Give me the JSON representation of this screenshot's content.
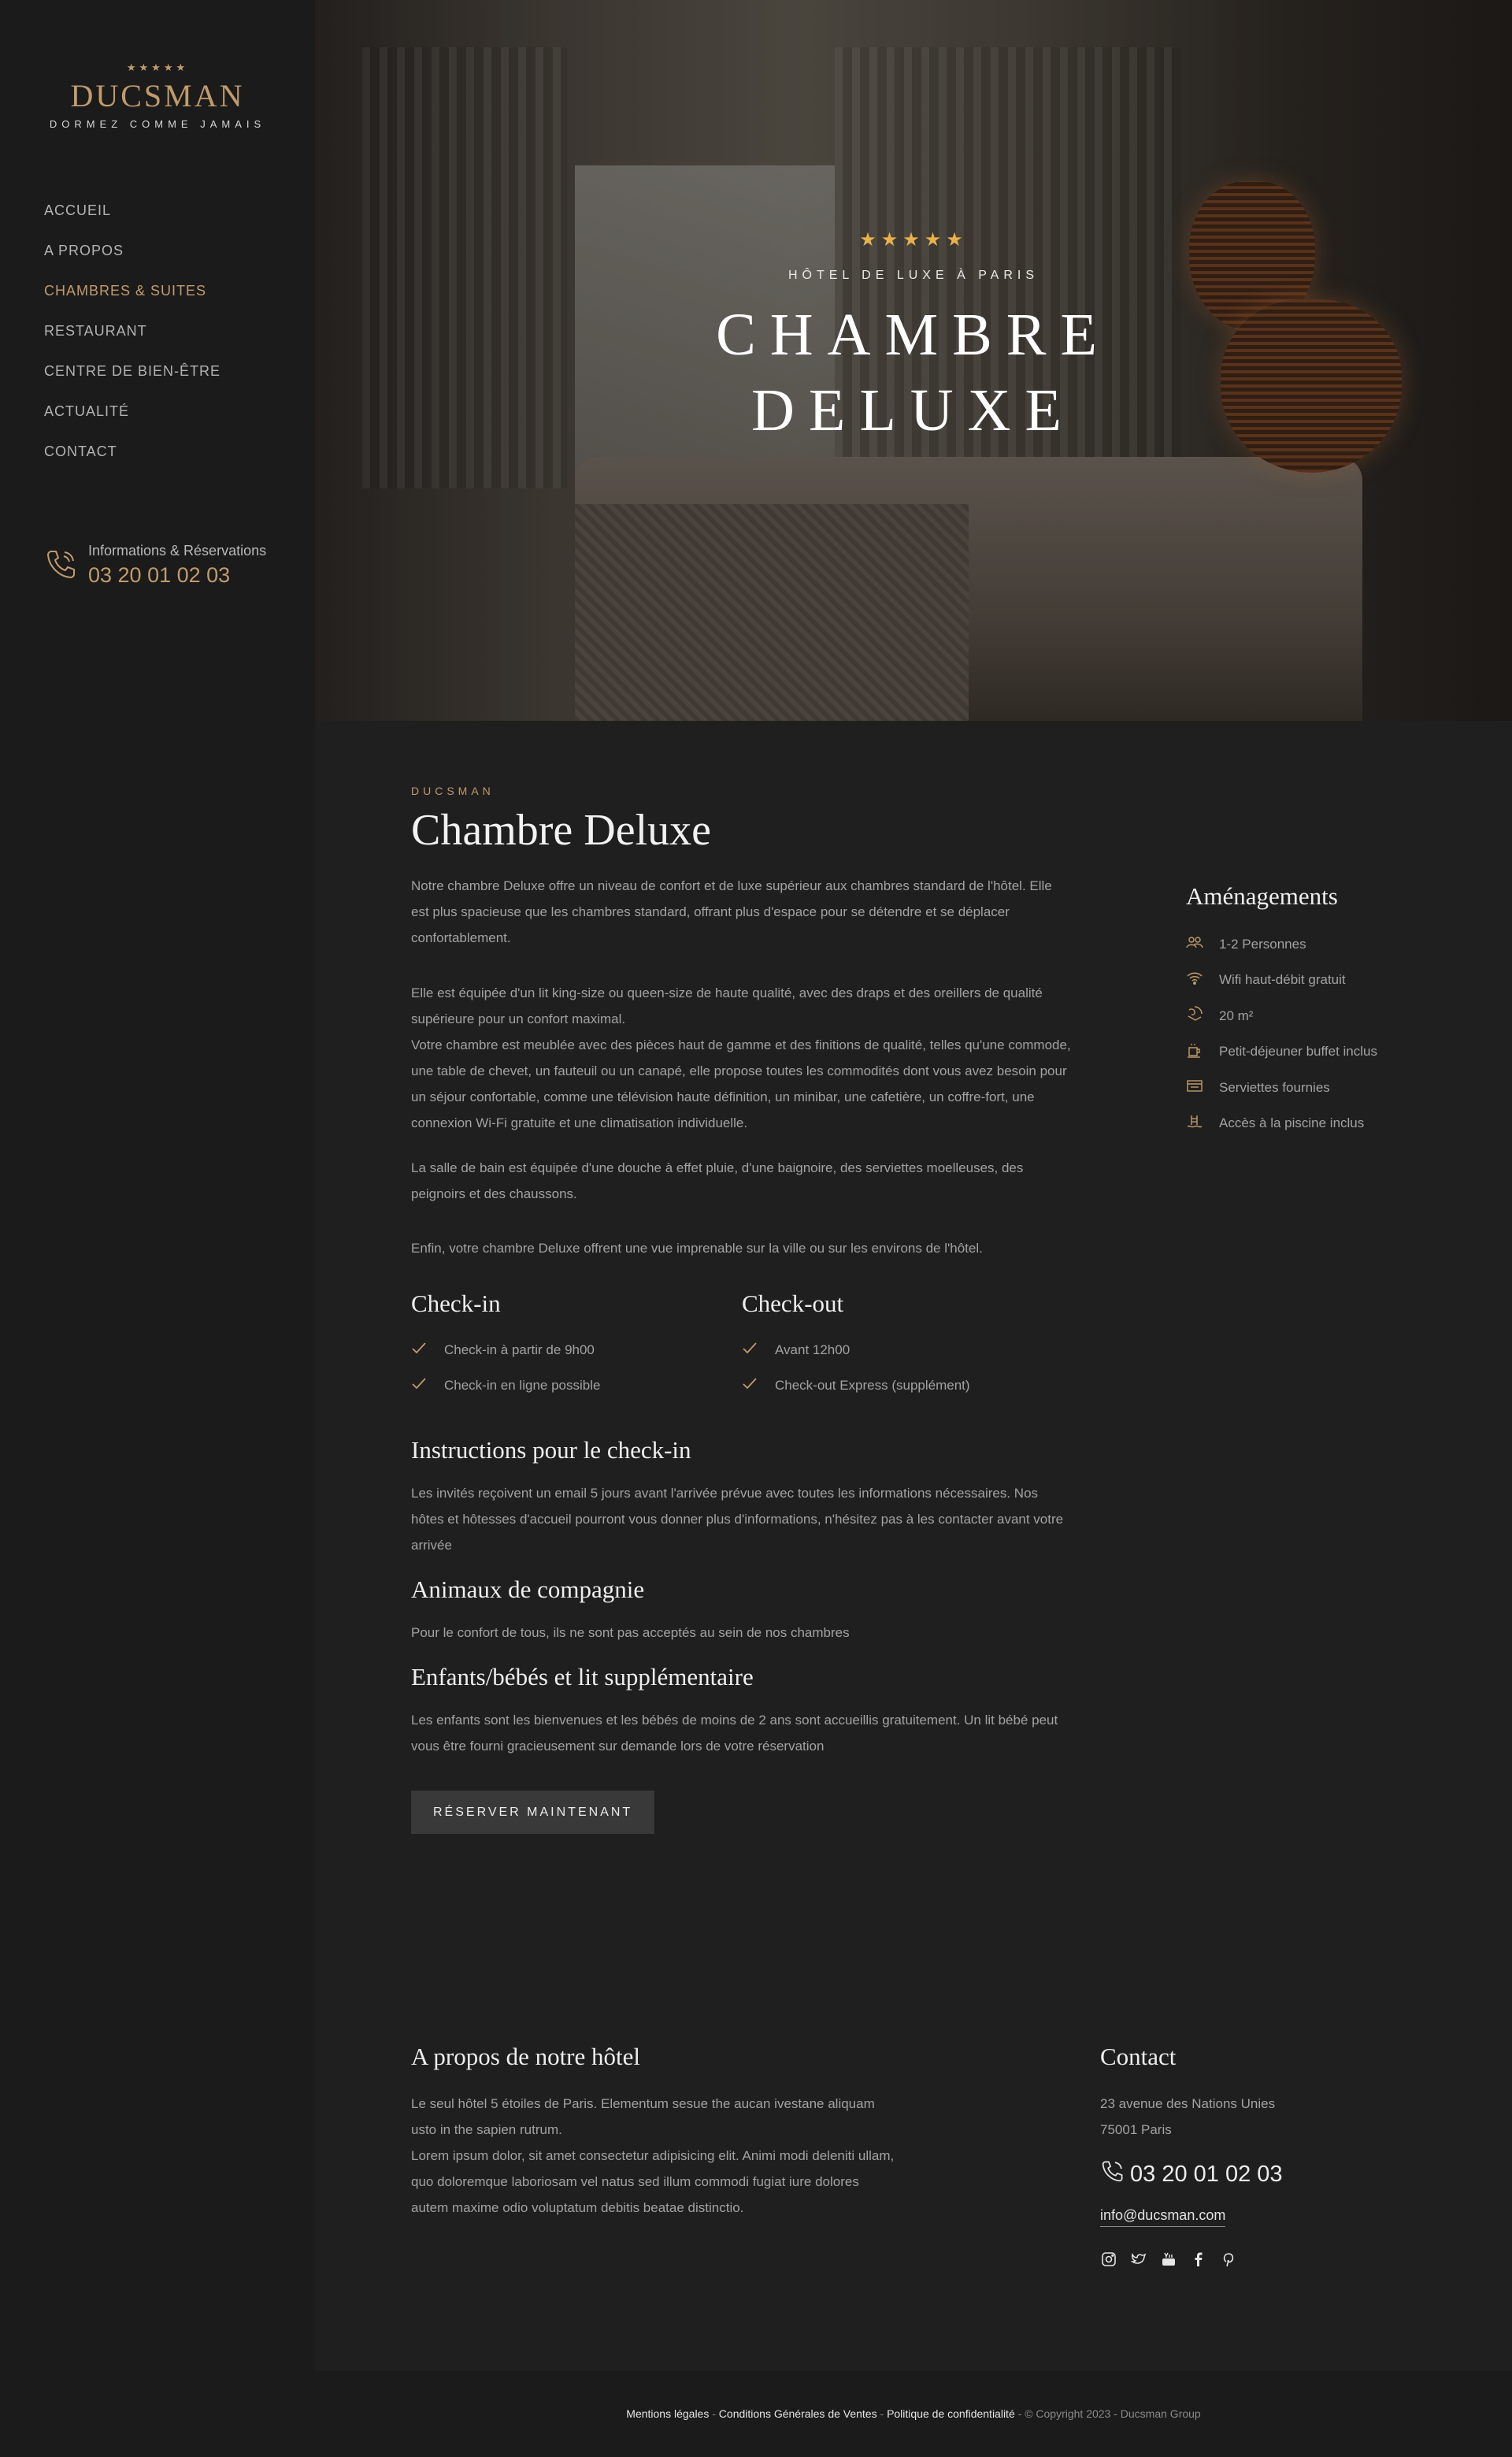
{
  "brand": {
    "stars": "★★★★★",
    "name": "DUCSMAN",
    "tagline": "DORMEZ COMME JAMAIS"
  },
  "nav": {
    "items": [
      {
        "label": "ACCUEIL"
      },
      {
        "label": "A PROPOS"
      },
      {
        "label": "CHAMBRES & SUITES"
      },
      {
        "label": "RESTAURANT"
      },
      {
        "label": "CENTRE DE BIEN-ÊTRE"
      },
      {
        "label": "ACTUALITÉ"
      },
      {
        "label": "CONTACT"
      }
    ],
    "active_index": 2
  },
  "sidebar_contact": {
    "label": "Informations & Réservations",
    "phone": "03 20 01 02 03"
  },
  "hero": {
    "stars": "★★★★★",
    "subtitle": "HÔTEL DE LUXE À PARIS",
    "title_line1": "CHAMBRE",
    "title_line2": "DELUXE"
  },
  "room": {
    "kicker": "DUCSMAN",
    "title": "Chambre Deluxe",
    "p1": "Notre chambre Deluxe offre un niveau de confort et de luxe supérieur aux chambres standard de l'hôtel. Elle est plus spacieuse que les chambres standard, offrant plus d'espace pour se détendre et se déplacer confortablement.",
    "p2": "Elle est équipée d'un lit king-size ou queen-size de haute qualité, avec des draps et des oreillers de qualité supérieure pour un confort maximal.",
    "p3": "Votre chambre est meublée avec des pièces haut de gamme et des finitions de qualité, telles qu'une commode, une table de chevet, un fauteuil ou un canapé, elle propose toutes les commodités dont vous avez besoin pour un séjour confortable, comme une télévision haute définition, un minibar, une cafetière, un coffre-fort, une connexion Wi-Fi gratuite et une climatisation individuelle.",
    "p4": "La salle de bain est équipée d'une douche à effet pluie, d'une baignoire, des serviettes moelleuses, des peignoirs et des chaussons.",
    "p5": "Enfin, votre chambre Deluxe offrent une vue imprenable sur la ville ou sur les environs de l'hôtel."
  },
  "checkin": {
    "title": "Check-in",
    "items": [
      "Check-in à partir de 9h00",
      "Check-in en ligne possible"
    ]
  },
  "checkout": {
    "title": "Check-out",
    "items": [
      "Avant 12h00",
      "Check-out Express (supplément)"
    ]
  },
  "instructions": {
    "title": "Instructions pour le check-in",
    "text": "Les invités reçoivent un email 5 jours avant l'arrivée prévue avec toutes les informations nécessaires. Nos hôtes et hôtesses d'accueil pourront vous donner plus d'informations, n'hésitez pas à les contacter avant votre arrivée"
  },
  "pets": {
    "title": "Animaux de compagnie",
    "text": "Pour le confort de tous, ils ne sont pas acceptés au sein de nos chambres"
  },
  "children": {
    "title": "Enfants/bébés et lit supplémentaire",
    "text": "Les enfants sont les bienvenues et les bébés de moins de 2 ans sont accueillis gratuitement. Un lit bébé peut vous être fourni gracieusement sur demande lors de votre réservation"
  },
  "cta": {
    "label": "RÉSERVER MAINTENANT"
  },
  "amenities": {
    "title": "Aménagements",
    "items": [
      {
        "icon": "people-icon",
        "label": "1-2 Personnes"
      },
      {
        "icon": "wifi-icon",
        "label": "Wifi haut-débit gratuit"
      },
      {
        "icon": "area-icon",
        "label": "20 m²"
      },
      {
        "icon": "breakfast-icon",
        "label": "Petit-déjeuner buffet inclus"
      },
      {
        "icon": "towel-icon",
        "label": "Serviettes fournies"
      },
      {
        "icon": "pool-icon",
        "label": "Accès à la piscine inclus"
      }
    ]
  },
  "footer": {
    "about_title": "A propos de notre hôtel",
    "about_text_1": "Le seul hôtel 5 étoiles de Paris. Elementum sesue the aucan ivestane aliquam usto in the sapien rutrum.",
    "about_text_2": "Lorem ipsum dolor, sit amet consectetur adipisicing elit. Animi modi deleniti ullam, quo doloremque laboriosam vel natus sed illum commodi fugiat iure dolores autem maxime odio voluptatum debitis beatae distinctio.",
    "contact_title": "Contact",
    "address_1": "23 avenue des Nations Unies",
    "address_2": "75001 Paris",
    "phone": "03 20 01 02 03",
    "email": "info@ducsman.com",
    "socials": [
      "instagram-icon",
      "twitter-icon",
      "youtube-icon",
      "facebook-icon",
      "pinterest-icon"
    ]
  },
  "legal": {
    "mentions": "Mentions légales",
    "cgv": "Conditions Générales de Ventes",
    "privacy": "Politique de confidentialité",
    "copyright": "© Copyright 2023 - Ducsman Group",
    "sep": " - "
  },
  "colors": {
    "accent": "#c19b6c",
    "background": "#1f1f1f",
    "sidebar": "#1b1b1b",
    "star": "#e8b14d"
  }
}
